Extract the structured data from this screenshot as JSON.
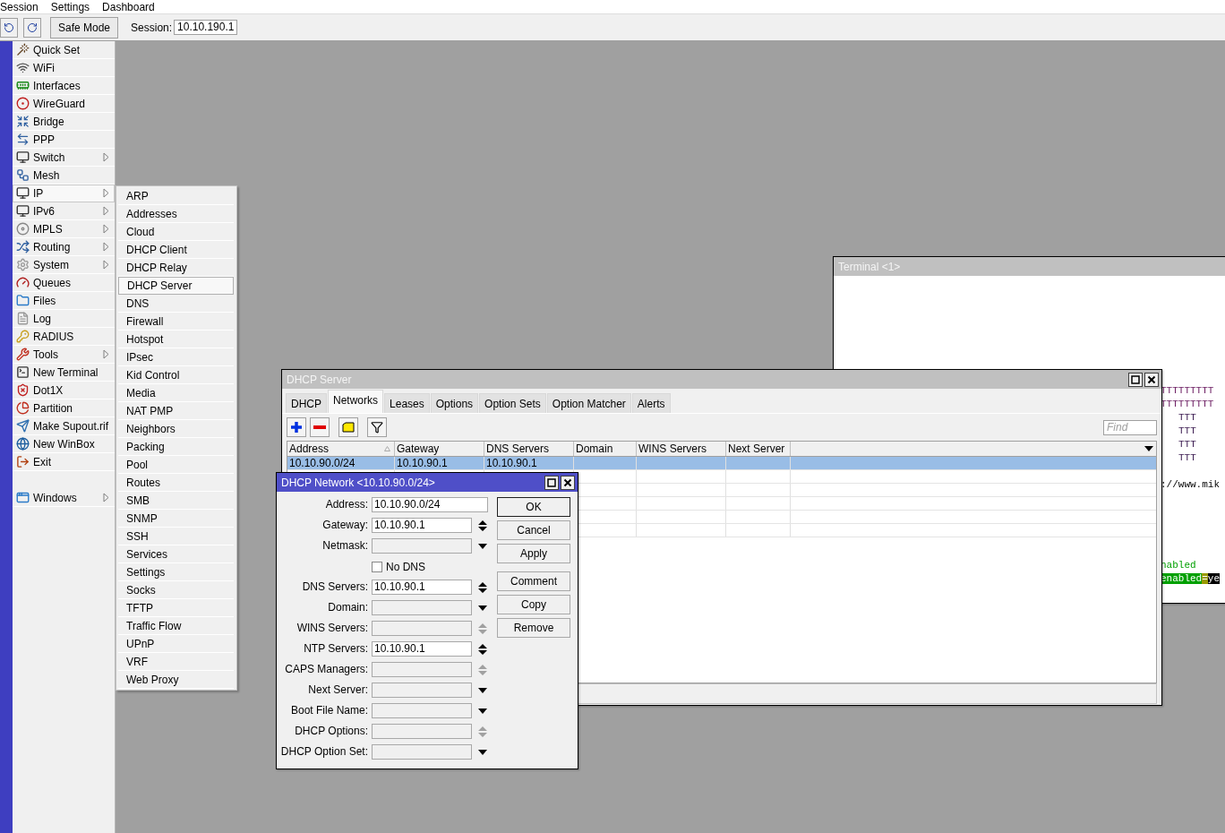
{
  "menu_bar": [
    "Session",
    "Settings",
    "Dashboard"
  ],
  "toolbar": {
    "safe_mode": "Safe Mode",
    "session_label": "Session:",
    "session_value": "10.10.190.1"
  },
  "sidebar": {
    "items": [
      {
        "label": "Quick Set",
        "has_submenu": false,
        "selected": false
      },
      {
        "label": "WiFi",
        "has_submenu": false,
        "selected": false
      },
      {
        "label": "Interfaces",
        "has_submenu": false,
        "selected": false
      },
      {
        "label": "WireGuard",
        "has_submenu": false,
        "selected": false
      },
      {
        "label": "Bridge",
        "has_submenu": false,
        "selected": false
      },
      {
        "label": "PPP",
        "has_submenu": false,
        "selected": false
      },
      {
        "label": "Switch",
        "has_submenu": true,
        "selected": false
      },
      {
        "label": "Mesh",
        "has_submenu": false,
        "selected": false
      },
      {
        "label": "IP",
        "has_submenu": true,
        "selected": true
      },
      {
        "label": "IPv6",
        "has_submenu": true,
        "selected": false
      },
      {
        "label": "MPLS",
        "has_submenu": true,
        "selected": false
      },
      {
        "label": "Routing",
        "has_submenu": true,
        "selected": false
      },
      {
        "label": "System",
        "has_submenu": true,
        "selected": false
      },
      {
        "label": "Queues",
        "has_submenu": false,
        "selected": false
      },
      {
        "label": "Files",
        "has_submenu": false,
        "selected": false
      },
      {
        "label": "Log",
        "has_submenu": false,
        "selected": false
      },
      {
        "label": "RADIUS",
        "has_submenu": false,
        "selected": false
      },
      {
        "label": "Tools",
        "has_submenu": true,
        "selected": false
      },
      {
        "label": "New Terminal",
        "has_submenu": false,
        "selected": false
      },
      {
        "label": "Dot1X",
        "has_submenu": false,
        "selected": false
      },
      {
        "label": "Partition",
        "has_submenu": false,
        "selected": false
      },
      {
        "label": "Make Supout.rif",
        "has_submenu": false,
        "selected": false
      },
      {
        "label": "New WinBox",
        "has_submenu": false,
        "selected": false
      },
      {
        "label": "Exit",
        "has_submenu": false,
        "selected": false
      }
    ],
    "windows_item": {
      "label": "Windows",
      "has_submenu": true
    }
  },
  "submenu": {
    "items": [
      {
        "label": "ARP",
        "selected": false
      },
      {
        "label": "Addresses",
        "selected": false
      },
      {
        "label": "Cloud",
        "selected": false
      },
      {
        "label": "DHCP Client",
        "selected": false
      },
      {
        "label": "DHCP Relay",
        "selected": false
      },
      {
        "label": "DHCP Server",
        "selected": true
      },
      {
        "label": "DNS",
        "selected": false
      },
      {
        "label": "Firewall",
        "selected": false
      },
      {
        "label": "Hotspot",
        "selected": false
      },
      {
        "label": "IPsec",
        "selected": false
      },
      {
        "label": "Kid Control",
        "selected": false
      },
      {
        "label": "Media",
        "selected": false
      },
      {
        "label": "NAT PMP",
        "selected": false
      },
      {
        "label": "Neighbors",
        "selected": false
      },
      {
        "label": "Packing",
        "selected": false
      },
      {
        "label": "Pool",
        "selected": false
      },
      {
        "label": "Routes",
        "selected": false
      },
      {
        "label": "SMB",
        "selected": false
      },
      {
        "label": "SNMP",
        "selected": false
      },
      {
        "label": "SSH",
        "selected": false
      },
      {
        "label": "Services",
        "selected": false
      },
      {
        "label": "Settings",
        "selected": false
      },
      {
        "label": "Socks",
        "selected": false
      },
      {
        "label": "TFTP",
        "selected": false
      },
      {
        "label": "Traffic Flow",
        "selected": false
      },
      {
        "label": "UPnP",
        "selected": false
      },
      {
        "label": "VRF",
        "selected": false
      },
      {
        "label": "Web Proxy",
        "selected": false
      }
    ]
  },
  "terminal": {
    "title": "Terminal <1>",
    "active": false,
    "lines": [
      {
        "kind": "banner",
        "text": "TTTTTTTTT"
      },
      {
        "kind": "banner",
        "text": "TTTTTTTTT"
      },
      {
        "kind": "banner-indent",
        "text": "TTT"
      },
      {
        "kind": "banner-indent",
        "text": "TTT"
      },
      {
        "kind": "banner-indent",
        "text": "TTT"
      },
      {
        "kind": "banner-indent",
        "text": "TTT"
      },
      {
        "kind": "url",
        "text": "://www.mik"
      },
      {
        "kind": "status",
        "text": "nabled"
      },
      {
        "kind": "highlight",
        "parts": [
          "enabled",
          "=",
          "ye"
        ]
      }
    ]
  },
  "dhcp_server": {
    "title": "DHCP Server",
    "active": false,
    "tabs": [
      {
        "label": "DHCP",
        "selected": false
      },
      {
        "label": "Networks",
        "selected": true
      },
      {
        "label": "Leases",
        "selected": false
      },
      {
        "label": "Options",
        "selected": false
      },
      {
        "label": "Option Sets",
        "selected": false
      },
      {
        "label": "Option Matcher",
        "selected": false
      },
      {
        "label": "Alerts",
        "selected": false
      }
    ],
    "find": {
      "placeholder": "Find"
    },
    "columns": [
      {
        "label": "Address",
        "sorted": true
      },
      {
        "label": "Gateway",
        "sorted": false
      },
      {
        "label": "DNS Servers",
        "sorted": false
      },
      {
        "label": "Domain",
        "sorted": false
      },
      {
        "label": "WINS Servers",
        "sorted": false
      },
      {
        "label": "Next Server",
        "sorted": false
      }
    ],
    "rows": [
      {
        "address": "10.10.90.0/24",
        "gateway": "10.10.90.1",
        "dns_servers": "10.10.90.1",
        "selected": true
      }
    ]
  },
  "dialog": {
    "title": "DHCP Network <10.10.90.0/24>",
    "active": true,
    "fields": [
      {
        "kind": "text",
        "label": "Address:",
        "value": "10.10.90.0/24"
      },
      {
        "kind": "spin",
        "label": "Gateway:",
        "value": "10.10.90.1",
        "arrows_enabled": true
      },
      {
        "kind": "dropdown",
        "label": "Netmask:"
      },
      {
        "kind": "checkbox",
        "label": "No DNS",
        "checked": false
      },
      {
        "kind": "spin",
        "label": "DNS Servers:",
        "value": "10.10.90.1",
        "arrows_enabled": true
      },
      {
        "kind": "dropdown",
        "label": "Domain:"
      },
      {
        "kind": "spin",
        "label": "WINS Servers:",
        "arrows_enabled": false
      },
      {
        "kind": "spin",
        "label": "NTP Servers:",
        "value": "10.10.90.1",
        "arrows_enabled": true
      },
      {
        "kind": "spin",
        "label": "CAPS Managers:",
        "arrows_enabled": false
      },
      {
        "kind": "dropdown",
        "label": "Next Server:"
      },
      {
        "kind": "dropdown",
        "label": "Boot File Name:"
      },
      {
        "kind": "spin",
        "label": "DHCP Options:",
        "arrows_enabled": false
      },
      {
        "kind": "dropdown",
        "label": "DHCP Option Set:"
      }
    ],
    "buttons": [
      {
        "label": "OK",
        "default": true
      },
      {
        "label": "Cancel",
        "default": false
      },
      {
        "label": "Apply",
        "default": false
      },
      {
        "label": "Comment",
        "default": false
      },
      {
        "label": "Copy",
        "default": false
      },
      {
        "label": "Remove",
        "default": false
      }
    ]
  }
}
